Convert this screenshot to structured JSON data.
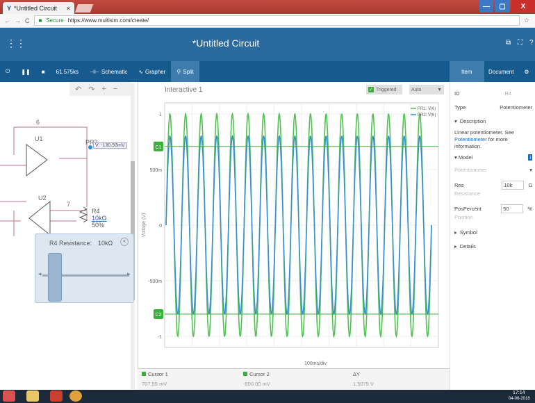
{
  "browser": {
    "tab_title": "*Untitled Circuit",
    "tab_close": "×",
    "secure_label": "Secure",
    "url": "https://www.multisim.com/create/"
  },
  "app": {
    "title": "*Untitled Circuit"
  },
  "toolbar": {
    "time": "61.575ks",
    "schematic": "Schematic",
    "grapher": "Grapher",
    "split": "Split"
  },
  "right_tabs": {
    "item": "Item",
    "document": "Document"
  },
  "properties": {
    "id_label": "ID",
    "id_value": "R4",
    "type_label": "Type",
    "type_value": "Potentiometer",
    "description_header": "Description",
    "description_text": "Linear potentiometer. See",
    "description_link": "Potentiometer",
    "description_suffix": "for more information.",
    "model_header": "Model",
    "model_value": "Potentiometer",
    "res_label": "Res",
    "res_sub": "Resistance",
    "res_value": "10k",
    "res_unit": "Ω",
    "pos_label": "PosPercent",
    "pos_sub": "Position",
    "pos_value": "50",
    "pos_unit": "%",
    "symbol_header": "Symbol",
    "details_header": "Details"
  },
  "schematic": {
    "u1": "U1",
    "u2": "U2",
    "net6": "6",
    "net7": "7",
    "probe_name": "PR2",
    "probe_value": "V: -130.93mV",
    "r4_name": "R4",
    "r4_value": "10kΩ",
    "r4_pct": "50%"
  },
  "popup": {
    "title": "R4 Resistance:",
    "value": "10kΩ",
    "position_percent": 50
  },
  "grapher": {
    "title": "Interactive 1",
    "triggered": "Triggered",
    "auto": "Auto",
    "legend1": "PR1: V(6)",
    "legend2": "PR2: V(6)",
    "y_ticks": [
      "1",
      "500m",
      "0",
      "-500m",
      "-1"
    ],
    "ylabel": "Voltage (V)",
    "xdiv": "100ms/div",
    "c1": "C1",
    "c2": "C2"
  },
  "cursors": {
    "c1_label": "Cursor 1",
    "c1_value": "707.55 mV",
    "c2_label": "Cursor 2",
    "c2_value": "-800.00 mV",
    "dy_label": "ΔY",
    "dy_value": "1.5075 V"
  },
  "taskbar": {
    "time": "17:14",
    "date": "04-06-2018"
  },
  "chart_data": {
    "type": "line",
    "series": [
      {
        "name": "PR1: V(6)",
        "color": "#4fc24f",
        "amplitude": 1.0
      },
      {
        "name": "PR2: V(6)",
        "color": "#3a8fd0",
        "amplitude": 0.8
      }
    ],
    "cycles": 17,
    "ylim": [
      -1.1,
      1.1
    ],
    "cursor1": 0.70755,
    "cursor2": -0.8
  },
  "colors": {
    "accent": "#2a6a9e",
    "toolbar": "#175a8e",
    "green": "#4fc24f",
    "blue": "#3a8fd0"
  }
}
